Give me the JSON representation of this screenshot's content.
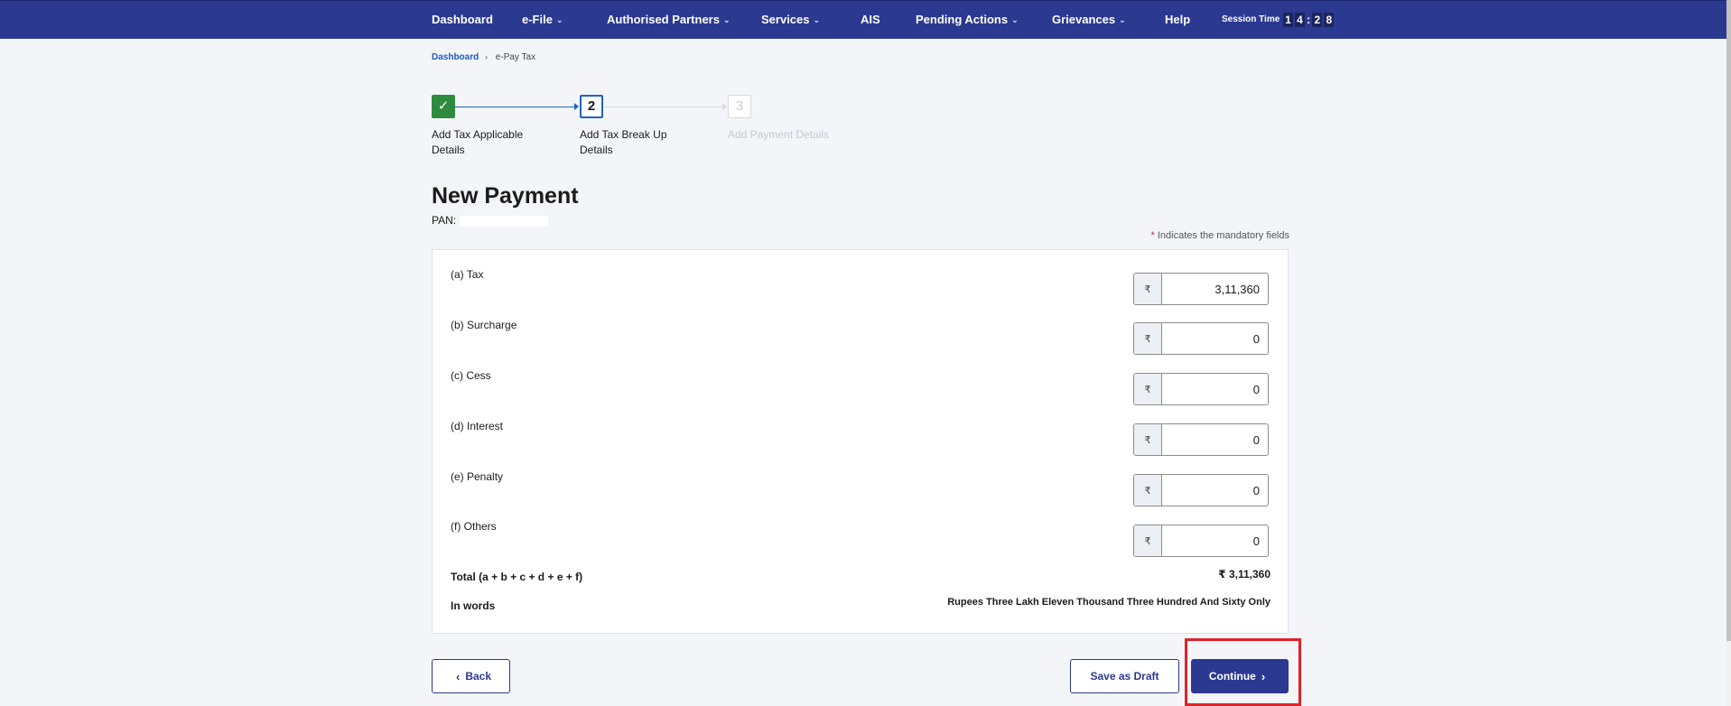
{
  "nav": {
    "items": [
      {
        "label": "Dashboard",
        "has_dropdown": false
      },
      {
        "label": "e-File",
        "has_dropdown": true
      },
      {
        "label": "Authorised Partners",
        "has_dropdown": true
      },
      {
        "label": "Services",
        "has_dropdown": true
      },
      {
        "label": "AIS",
        "has_dropdown": false
      },
      {
        "label": "Pending Actions",
        "has_dropdown": true
      },
      {
        "label": "Grievances",
        "has_dropdown": true
      },
      {
        "label": "Help",
        "has_dropdown": false
      }
    ],
    "session_label": "Session Time",
    "session_digits": [
      "1",
      "4",
      "2",
      "8"
    ],
    "dropdown_glyph": "⌄",
    "bg_color": "#2b3990"
  },
  "breadcrumb": {
    "home": "Dashboard",
    "separator": "›",
    "current": "e-Pay Tax"
  },
  "stepper": {
    "steps": [
      {
        "number": "",
        "label": "Add Tax Applicable Details",
        "state": "complete",
        "icon": "check-icon"
      },
      {
        "number": "2",
        "label": "Add Tax Break Up Details",
        "state": "active"
      },
      {
        "number": "3",
        "label": "Add Payment Details",
        "state": "upcoming"
      }
    ],
    "check_glyph": "✓"
  },
  "page": {
    "title": "New Payment",
    "pan_label": "PAN:",
    "mandatory_star": "*",
    "mandatory_note": "Indicates the mandatory fields"
  },
  "form": {
    "currency_symbol": "₹",
    "rows": [
      {
        "label": "(a) Tax",
        "value": "3,11,360"
      },
      {
        "label": "(b) Surcharge",
        "value": "0"
      },
      {
        "label": "(c) Cess",
        "value": "0"
      },
      {
        "label": "(d) Interest",
        "value": "0"
      },
      {
        "label": "(e) Penalty",
        "value": "0"
      },
      {
        "label": "(f) Others",
        "value": "0"
      }
    ],
    "total_label": "Total (a + b + c + d + e + f)",
    "total_value": "₹ 3,11,360",
    "words_label": "In words",
    "words_value": "Rupees Three Lakh Eleven Thousand Three Hundred And Sixty Only"
  },
  "actions": {
    "back": "Back",
    "back_icon": "‹",
    "save_draft": "Save as Draft",
    "continue": "Continue",
    "continue_icon": "›",
    "highlight_color": "#e02127"
  }
}
